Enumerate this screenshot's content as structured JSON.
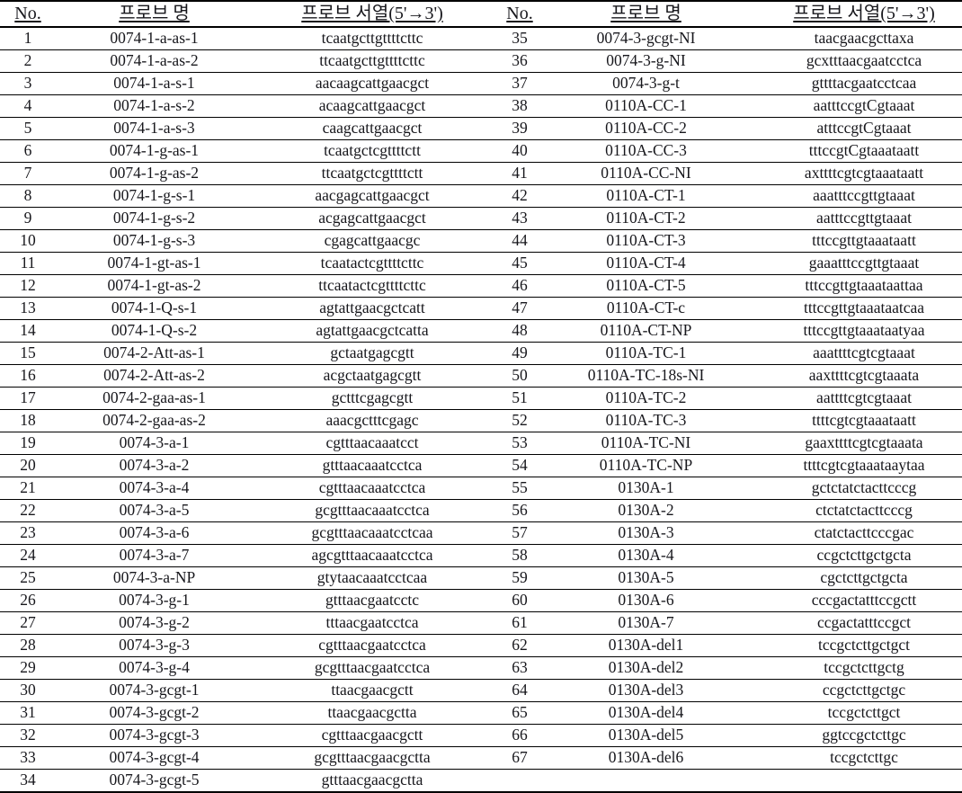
{
  "table": {
    "headers": {
      "no": "No.",
      "probe_name": "프로브 명",
      "probe_sequence": "프로브 서열(5'→3')"
    },
    "left_rows": [
      {
        "no": "1",
        "name": "0074-1-a-as-1",
        "seq": "tcaatgcttgttttcttc"
      },
      {
        "no": "2",
        "name": "0074-1-a-as-2",
        "seq": "ttcaatgcttgttttcttc"
      },
      {
        "no": "3",
        "name": "0074-1-a-s-1",
        "seq": "aacaagcattgaacgct"
      },
      {
        "no": "4",
        "name": "0074-1-a-s-2",
        "seq": "acaagcattgaacgct"
      },
      {
        "no": "5",
        "name": "0074-1-a-s-3",
        "seq": "caagcattgaacgct"
      },
      {
        "no": "6",
        "name": "0074-1-g-as-1",
        "seq": "tcaatgctcgttttctt"
      },
      {
        "no": "7",
        "name": "0074-1-g-as-2",
        "seq": "ttcaatgctcgttttctt"
      },
      {
        "no": "8",
        "name": "0074-1-g-s-1",
        "seq": "aacgagcattgaacgct"
      },
      {
        "no": "9",
        "name": "0074-1-g-s-2",
        "seq": "acgagcattgaacgct"
      },
      {
        "no": "10",
        "name": "0074-1-g-s-3",
        "seq": "cgagcattgaacgc"
      },
      {
        "no": "11",
        "name": "0074-1-gt-as-1",
        "seq": "tcaatactcgttttcttc"
      },
      {
        "no": "12",
        "name": "0074-1-gt-as-2",
        "seq": "ttcaatactcgttttcttc"
      },
      {
        "no": "13",
        "name": "0074-1-Q-s-1",
        "seq": "agtattgaacgctcatt"
      },
      {
        "no": "14",
        "name": "0074-1-Q-s-2",
        "seq": "agtattgaacgctcatta"
      },
      {
        "no": "15",
        "name": "0074-2-Att-as-1",
        "seq": "gctaatgagcgtt"
      },
      {
        "no": "16",
        "name": "0074-2-Att-as-2",
        "seq": "acgctaatgagcgtt"
      },
      {
        "no": "17",
        "name": "0074-2-gaa-as-1",
        "seq": "gctttcgagcgtt"
      },
      {
        "no": "18",
        "name": "0074-2-gaa-as-2",
        "seq": "aaacgctttcgagc"
      },
      {
        "no": "19",
        "name": "0074-3-a-1",
        "seq": "cgtttaacaaatcct"
      },
      {
        "no": "20",
        "name": "0074-3-a-2",
        "seq": "gtttaacaaatcctca"
      },
      {
        "no": "21",
        "name": "0074-3-a-4",
        "seq": "cgtttaacaaatcctca"
      },
      {
        "no": "22",
        "name": "0074-3-a-5",
        "seq": "gcgtttaacaaatcctca"
      },
      {
        "no": "23",
        "name": "0074-3-a-6",
        "seq": "gcgtttaacaaatcctcaa"
      },
      {
        "no": "24",
        "name": "0074-3-a-7",
        "seq": "agcgtttaacaaatcctca"
      },
      {
        "no": "25",
        "name": "0074-3-a-NP",
        "seq": "gtytaacaaatcctcaa"
      },
      {
        "no": "26",
        "name": "0074-3-g-1",
        "seq": "gtttaacgaatcctc"
      },
      {
        "no": "27",
        "name": "0074-3-g-2",
        "seq": "tttaacgaatcctca"
      },
      {
        "no": "28",
        "name": "0074-3-g-3",
        "seq": "cgtttaacgaatcctca"
      },
      {
        "no": "29",
        "name": "0074-3-g-4",
        "seq": "gcgtttaacgaatcctca"
      },
      {
        "no": "30",
        "name": "0074-3-gcgt-1",
        "seq": "ttaacgaacgctt"
      },
      {
        "no": "31",
        "name": "0074-3-gcgt-2",
        "seq": "ttaacgaacgctta"
      },
      {
        "no": "32",
        "name": "0074-3-gcgt-3",
        "seq": "cgtttaacgaacgctt"
      },
      {
        "no": "33",
        "name": "0074-3-gcgt-4",
        "seq": "gcgtttaacgaacgctta"
      },
      {
        "no": "34",
        "name": "0074-3-gcgt-5",
        "seq": "gtttaacgaacgctta"
      }
    ],
    "right_rows": [
      {
        "no": "35",
        "name": "0074-3-gcgt-NI",
        "seq": "taacgaacgcttaxa"
      },
      {
        "no": "36",
        "name": "0074-3-g-NI",
        "seq": "gcxtttaacgaatcctca"
      },
      {
        "no": "37",
        "name": "0074-3-g-t",
        "seq": "gttttacgaatcctcaa"
      },
      {
        "no": "38",
        "name": "0110A-CC-1",
        "seq": "aatttccgtCgtaaat"
      },
      {
        "no": "39",
        "name": "0110A-CC-2",
        "seq": "atttccgtCgtaaat"
      },
      {
        "no": "40",
        "name": "0110A-CC-3",
        "seq": "tttccgtCgtaaataatt"
      },
      {
        "no": "41",
        "name": "0110A-CC-NI",
        "seq": "axttttcgtcgtaaataatt"
      },
      {
        "no": "42",
        "name": "0110A-CT-1",
        "seq": "aaatttccgttgtaaat"
      },
      {
        "no": "43",
        "name": "0110A-CT-2",
        "seq": "aatttccgttgtaaat"
      },
      {
        "no": "44",
        "name": "0110A-CT-3",
        "seq": "tttccgttgtaaataatt"
      },
      {
        "no": "45",
        "name": "0110A-CT-4",
        "seq": "gaaatttccgttgtaaat"
      },
      {
        "no": "46",
        "name": "0110A-CT-5",
        "seq": "tttccgttgtaaataattaa"
      },
      {
        "no": "47",
        "name": "0110A-CT-c",
        "seq": "tttccgttgtaaataatcaa"
      },
      {
        "no": "48",
        "name": "0110A-CT-NP",
        "seq": "tttccgttgtaaataatyaa"
      },
      {
        "no": "49",
        "name": "0110A-TC-1",
        "seq": "aaattttcgtcgtaaat"
      },
      {
        "no": "50",
        "name": "0110A-TC-18s-NI",
        "seq": "aaxttttcgtcgtaaata"
      },
      {
        "no": "51",
        "name": "0110A-TC-2",
        "seq": "aattttcgtcgtaaat"
      },
      {
        "no": "52",
        "name": "0110A-TC-3",
        "seq": "ttttcgtcgtaaataatt"
      },
      {
        "no": "53",
        "name": "0110A-TC-NI",
        "seq": "gaaxttttcgtcgtaaata"
      },
      {
        "no": "54",
        "name": "0110A-TC-NP",
        "seq": "ttttcgtcgtaaataaytaa"
      },
      {
        "no": "55",
        "name": "0130A-1",
        "seq": "gctctatctacttcccg"
      },
      {
        "no": "56",
        "name": "0130A-2",
        "seq": "ctctatctacttcccg"
      },
      {
        "no": "57",
        "name": "0130A-3",
        "seq": "ctatctacttcccgac"
      },
      {
        "no": "58",
        "name": "0130A-4",
        "seq": "ccgctcttgctgcta"
      },
      {
        "no": "59",
        "name": "0130A-5",
        "seq": "cgctcttgctgcta"
      },
      {
        "no": "60",
        "name": "0130A-6",
        "seq": "cccgactatttccgctt"
      },
      {
        "no": "61",
        "name": "0130A-7",
        "seq": "ccgactatttccgct"
      },
      {
        "no": "62",
        "name": "0130A-del1",
        "seq": "tccgctcttgctgct"
      },
      {
        "no": "63",
        "name": "0130A-del2",
        "seq": "tccgctcttgctg"
      },
      {
        "no": "64",
        "name": "0130A-del3",
        "seq": "ccgctcttgctgc"
      },
      {
        "no": "65",
        "name": "0130A-del4",
        "seq": "tccgctcttgct"
      },
      {
        "no": "66",
        "name": "0130A-del5",
        "seq": "ggtccgctcttgc"
      },
      {
        "no": "67",
        "name": "0130A-del6",
        "seq": "tccgctcttgc"
      },
      {
        "no": "",
        "name": "",
        "seq": ""
      }
    ]
  }
}
